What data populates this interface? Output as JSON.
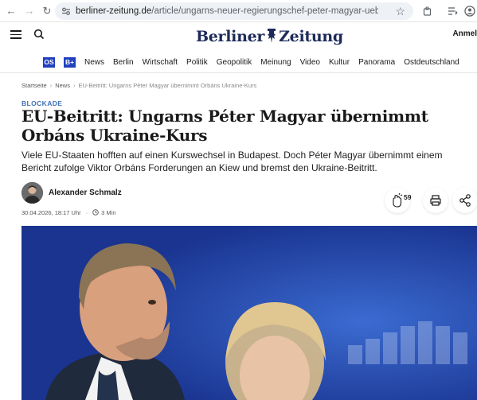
{
  "browser": {
    "url_host": "berliner-zeitung.de",
    "url_path": "/article/ungarns-neuer-regierungschef-peter-magyar-uebernimmt-orbans-kur..."
  },
  "site": {
    "logo_text_left": "Berliner",
    "logo_text_right": "Zeitung",
    "login_label": "Anmel"
  },
  "nav": {
    "badges": [
      "OS",
      "B+"
    ],
    "items": [
      "News",
      "Berlin",
      "Wirtschaft",
      "Politik",
      "Geopolitik",
      "Meinung",
      "Video",
      "Kultur",
      "Panorama",
      "Ostdeutschland"
    ]
  },
  "breadcrumb": {
    "home": "Startseite",
    "section": "News",
    "current": "EU-Beitritt: Ungarns Péter Magyar übernimmt Orbáns Ukraine-Kurs"
  },
  "article": {
    "kicker": "BLOCKADE",
    "headline": "EU-Beitritt: Ungarns Péter Magyar übernimmt Orbáns Ukraine-Kurs",
    "lead": "Viele EU-Staaten hofften auf einen Kurswechsel in Budapest. Doch Péter Magyar übernimmt einem Bericht zufolge Viktor Orbáns Forderungen an Kiew und bremst den Ukraine-Beitritt.",
    "author": "Alexander Schmalz",
    "date": "30.04.2026, 18:17 Uhr",
    "read_time": "3 Min",
    "clap_count": "59"
  },
  "colors": {
    "accent": "#3d6fb6",
    "badge": "#1f3fbf",
    "logo": "#1d2b5a"
  }
}
